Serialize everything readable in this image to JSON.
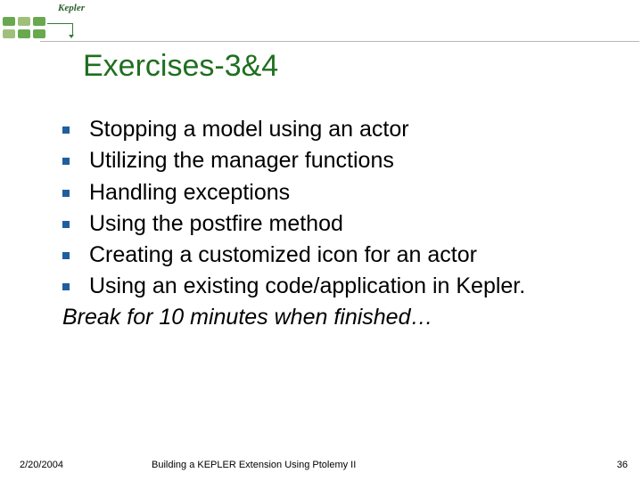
{
  "logo": {
    "brand": "Kepler"
  },
  "title": "Exercises-3&4",
  "bullets": [
    "Stopping a model using an actor",
    "Utilizing the manager functions",
    "Handling exceptions",
    "Using the postfire method",
    "Creating a customized icon for an actor",
    "Using an existing code/application in Kepler."
  ],
  "break_text": "Break for 10 minutes when finished…",
  "footer": {
    "date": "2/20/2004",
    "title": "Building a KEPLER Extension Using Ptolemy II",
    "page": "36"
  }
}
